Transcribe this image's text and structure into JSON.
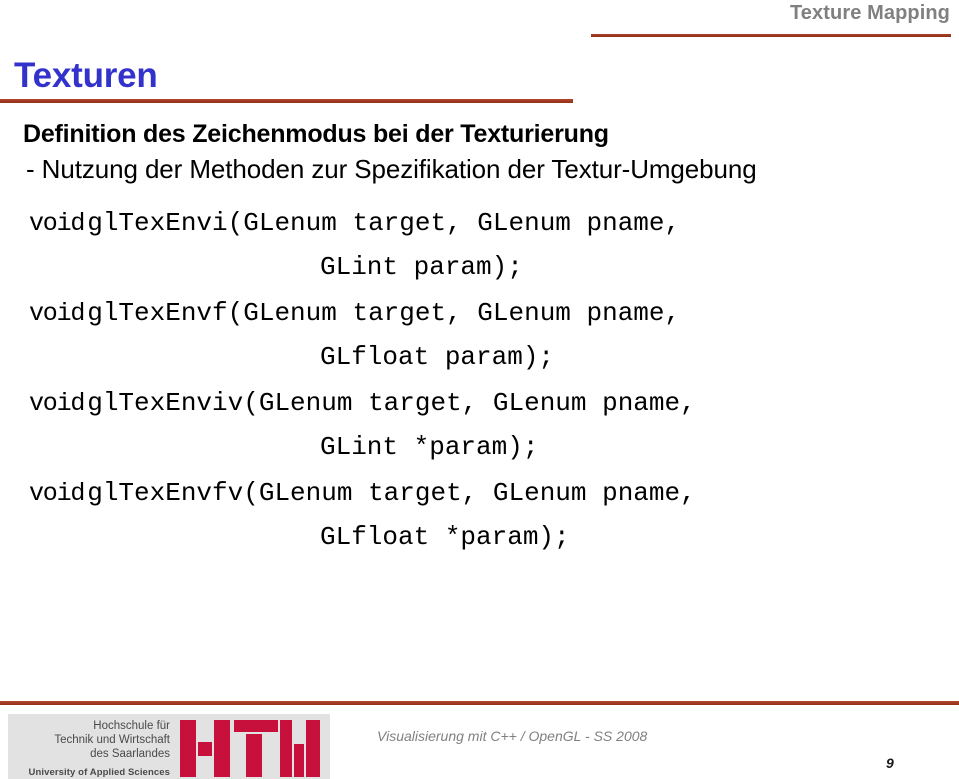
{
  "header": {
    "title": "Texture Mapping",
    "rule_color": "#99331a"
  },
  "slide": {
    "title": "Texturen",
    "title_color": "#3333cc",
    "rule_color": "#a33a20"
  },
  "content": {
    "heading": "Definition des Zeichenmodus bei der Texturierung",
    "subheading": "- Nutzung der Methoden zur Spezifikation der Textur-Umgebung"
  },
  "code": {
    "signatures": [
      {
        "keyword": "void",
        "first_line": "glTexEnvi(GLenum target, GLenum pname,",
        "second_line": "GLint param);"
      },
      {
        "keyword": "void",
        "first_line": "glTexEnvf(GLenum target, GLenum pname,",
        "second_line": "GLfloat param);"
      },
      {
        "keyword": "void",
        "first_line": "glTexEnviv(GLenum target, GLenum pname,",
        "second_line": "GLint *param);"
      },
      {
        "keyword": "void",
        "first_line": "glTexEnvfv(GLenum target, GLenum pname,",
        "second_line": "GLfloat *param);"
      }
    ]
  },
  "footer": {
    "rule_color": "#a33a20",
    "logo": {
      "line1": "Hochschule für",
      "line2": "Technik und Wirtschaft",
      "line3": "des Saarlandes",
      "subtitle": "University of Applied Sciences",
      "mark_color": "#c8103c",
      "background": "#e2e2e2",
      "wordmark": "HTW"
    },
    "course": "Visualisierung mit C++ / OpenGL -  SS 2008",
    "page_number": "9"
  }
}
